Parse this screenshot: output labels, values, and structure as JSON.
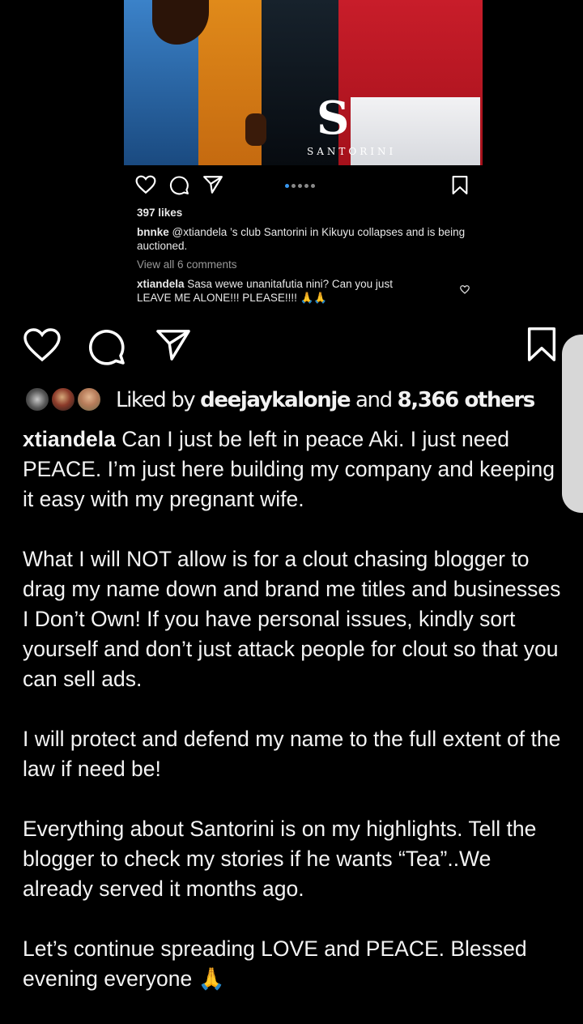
{
  "embedded_post": {
    "photo_logo_letter": "S",
    "photo_logo_word": "SANTORINI",
    "likes": "397 likes",
    "caption_user": "bnnke",
    "caption_text": " @xtiandela ’s club Santorini in Kikuyu collapses and is being auctioned.",
    "view_all_comments": "View all 6 comments",
    "comment_user": "xtiandela",
    "comment_text": " Sasa wewe unanitafutia nini? Can you just LEAVE ME ALONE!!! PLEASE!!!! 🙏🙏",
    "carousel_dots": 5,
    "active_dot": 0
  },
  "post": {
    "liked_by_prefix": "Liked by ",
    "liked_by_user": "deejaykalonje",
    "liked_by_and": " and ",
    "liked_by_others": "8,366 others",
    "username": "xtiandela",
    "caption_p1": " Can I just be left in peace Aki. I just need PEACE. I’m just here building my company and keeping it easy with my pregnant wife.",
    "caption_p2": "What I will NOT allow is for a clout chasing blogger to drag my name down and brand me titles and businesses I Don’t Own! If you have personal issues, kindly sort yourself and don’t just attack people for clout so that you can sell ads.",
    "caption_p3": "I will protect and defend my name to the full extent of the law if need be!",
    "caption_p4": "Everything about Santorini is on my highlights. Tell the blogger to check my stories if he wants “Tea”..We already served it months ago.",
    "caption_p5": "Let’s continue spreading LOVE and PEACE. Blessed evening everyone 🙏"
  },
  "icons": {
    "like": "heart-icon",
    "comment": "comment-icon",
    "share": "send-icon",
    "save": "bookmark-icon"
  },
  "colors": {
    "background": "#000000",
    "text": "#ffffff",
    "carousel_active": "#3897f0"
  }
}
